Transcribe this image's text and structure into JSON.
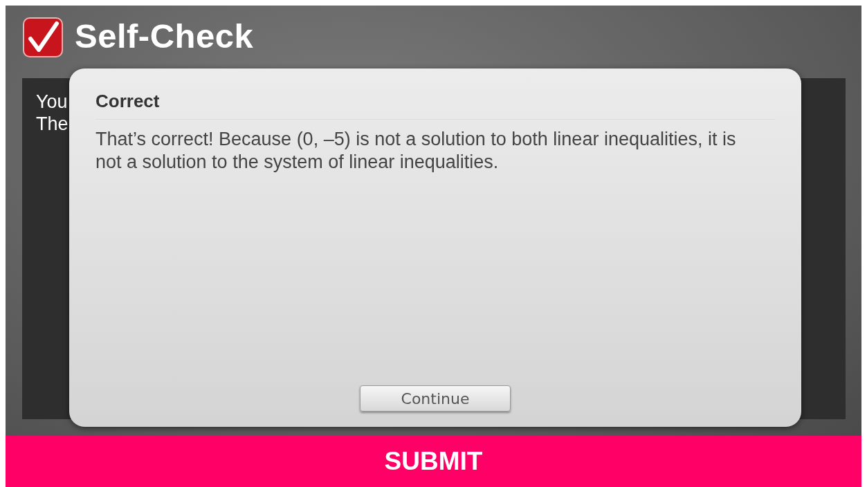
{
  "header": {
    "title": "Self-Check"
  },
  "question_panel": {
    "lines": [
      "You",
      "The"
    ]
  },
  "dialog": {
    "title": "Correct",
    "message": "That’s correct! Because (0, –5) is not a solution to both linear inequalities, it is not a solution to the system of linear inequalities.",
    "button": "Continue"
  },
  "submit_button": "SUBMIT"
}
